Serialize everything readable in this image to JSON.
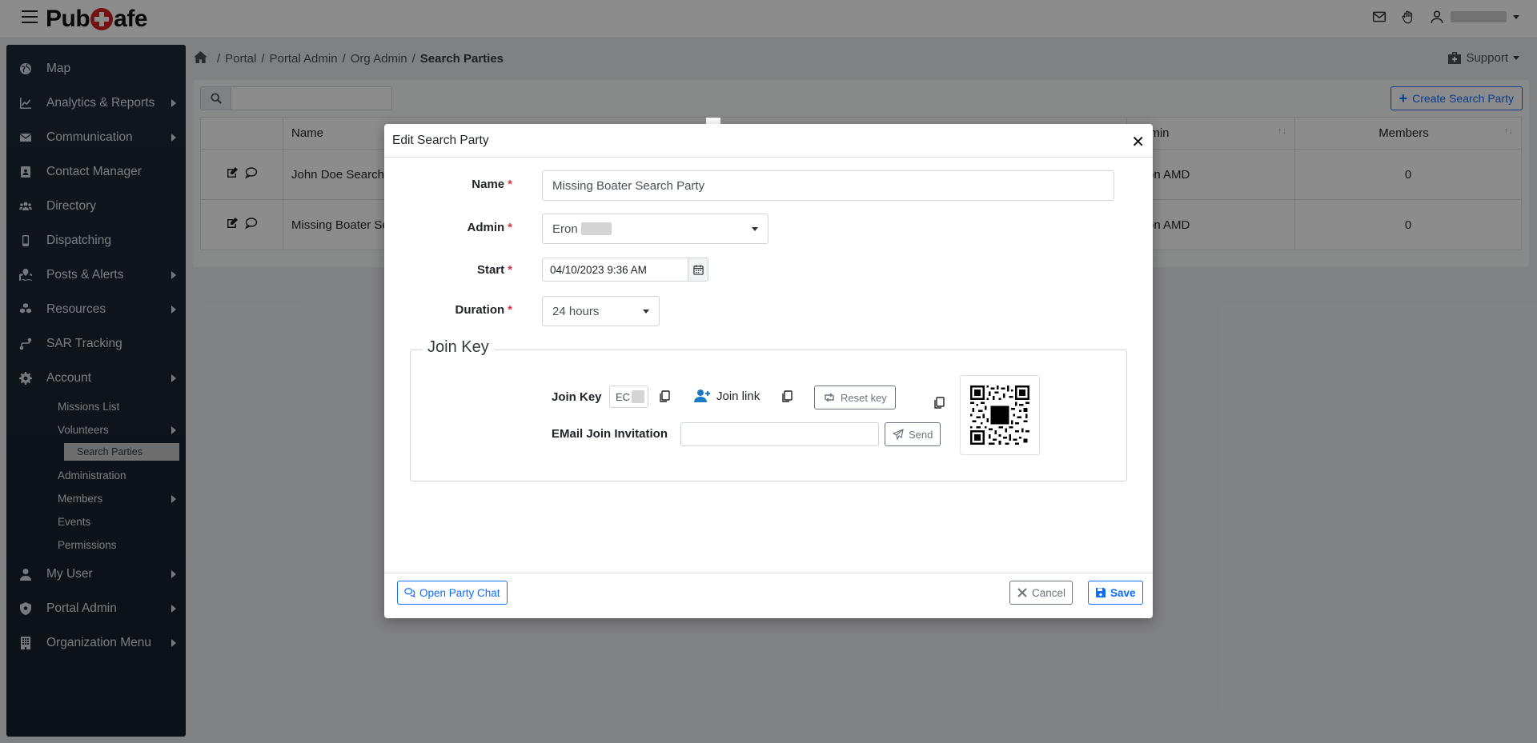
{
  "app": {
    "logo_left": "Pub",
    "logo_right": "afe"
  },
  "sidebar": {
    "items": [
      {
        "label": "Map",
        "icon": "globe-icon"
      },
      {
        "label": "Analytics & Reports",
        "icon": "chart-line-icon",
        "has_submenu": true
      },
      {
        "label": "Communication",
        "icon": "envelope-icon",
        "has_submenu": true
      },
      {
        "label": "Contact Manager",
        "icon": "address-book-icon"
      },
      {
        "label": "Directory",
        "icon": "users-icon"
      },
      {
        "label": "Dispatching",
        "icon": "mobile-icon"
      },
      {
        "label": "Posts & Alerts",
        "icon": "map-marked-icon",
        "has_submenu": true
      },
      {
        "label": "Resources",
        "icon": "cubes-icon",
        "has_submenu": true
      },
      {
        "label": "SAR Tracking",
        "icon": "route-icon"
      },
      {
        "label": "Account",
        "icon": "gear-icon",
        "has_submenu": true
      }
    ],
    "account_sub": [
      {
        "label": "Missions List"
      },
      {
        "label": "Volunteers",
        "has_submenu": true
      }
    ],
    "active_sub": "Search Parties",
    "account_sub2": [
      {
        "label": "Administration"
      },
      {
        "label": "Members",
        "has_submenu": true
      },
      {
        "label": "Events"
      },
      {
        "label": "Permissions"
      }
    ],
    "bottom_items": [
      {
        "label": "My User",
        "icon": "user-icon",
        "has_submenu": true
      },
      {
        "label": "Portal Admin",
        "icon": "shield-gear-icon",
        "has_submenu": true
      },
      {
        "label": "Organization Menu",
        "icon": "building-icon",
        "has_submenu": true
      }
    ]
  },
  "breadcrumb": {
    "items": [
      "Portal",
      "Portal Admin",
      "Org Admin"
    ],
    "current": "Search Parties"
  },
  "support_label": "Support",
  "toolbar": {
    "create_label": "Create Search Party",
    "search_value": ""
  },
  "table": {
    "columns": [
      "Name",
      "Admin",
      "Members"
    ],
    "rows": [
      {
        "name": "John Doe Search P",
        "admin": "Eron AMD",
        "members": "0"
      },
      {
        "name": "Missing Boater Sea",
        "admin": "Eron AMD",
        "members": "0"
      }
    ]
  },
  "modal": {
    "title": "Edit Search Party",
    "close_glyph": "✕",
    "name_label": "Name",
    "name_value": "Missing Boater Search Party",
    "admin_label": "Admin",
    "admin_value": "Eron",
    "start_label": "Start",
    "start_value": "04/10/2023 9:36 AM",
    "duration_label": "Duration",
    "duration_value": "24 hours",
    "required_mark": "*",
    "join_key_legend": "Join Key",
    "join_key_label": "Join Key",
    "join_key_value": "EC",
    "join_link_label": "Join link",
    "reset_key_label": "Reset key",
    "email_label": "EMail Join Invitation",
    "email_value": "",
    "send_label": "Send",
    "open_chat_label": "Open Party Chat",
    "cancel_label": "Cancel",
    "save_label": "Save"
  },
  "colors": {
    "primary": "#0d6efd",
    "danger": "#dc3545",
    "sidebar_bg": "#1d2a36",
    "active_sub_bg": "#c8c8c8"
  }
}
